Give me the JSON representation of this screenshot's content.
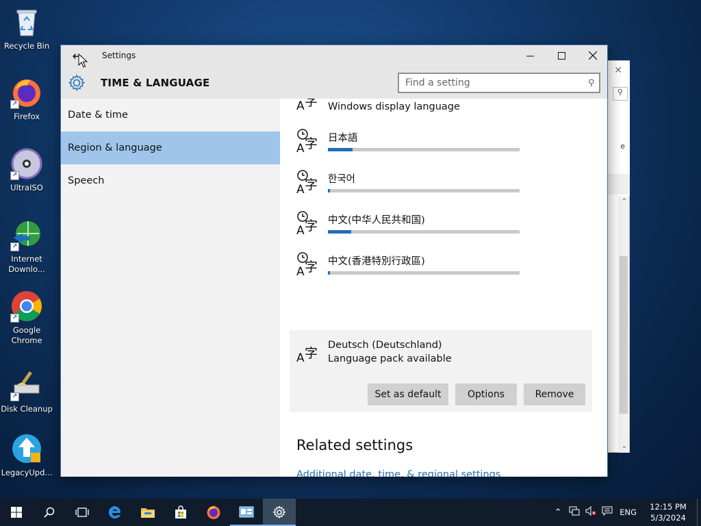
{
  "desktop": {
    "icons": [
      {
        "label": "Recycle Bin"
      },
      {
        "label": "Firefox"
      },
      {
        "label": "UltraISO"
      },
      {
        "label": "Internet Downlo..."
      },
      {
        "label": "Google Chrome"
      },
      {
        "label": "Disk Cleanup"
      },
      {
        "label": "LegacyUpd..."
      }
    ]
  },
  "window": {
    "title": "Settings",
    "section_title": "TIME & LANGUAGE",
    "search": {
      "placeholder": "Find a setting"
    },
    "sidebar": {
      "items": [
        {
          "label": "Date & time",
          "active": false
        },
        {
          "label": "Region & language",
          "active": true
        },
        {
          "label": "Speech",
          "active": false
        }
      ]
    },
    "languages": [
      {
        "name": "",
        "subtitle": "Windows display language",
        "progress": null
      },
      {
        "name": "日本語",
        "subtitle": "",
        "progress": 0.13
      },
      {
        "name": "한국어",
        "subtitle": "",
        "progress": 0.01
      },
      {
        "name": "中文(中华人民共和国)",
        "subtitle": "",
        "progress": 0.12
      },
      {
        "name": "中文(香港特別行政區)",
        "subtitle": "",
        "progress": 0.01
      }
    ],
    "selected_language": {
      "name": "Deutsch (Deutschland)",
      "subtitle": "Language pack available",
      "buttons": {
        "set_default": "Set as default",
        "options": "Options",
        "remove": "Remove"
      }
    },
    "related": {
      "title": "Related settings",
      "link": "Additional date, time, & regional settings"
    }
  },
  "taskbar": {
    "language": "ENG",
    "time": "12:15 PM",
    "date": "5/3/2024"
  },
  "colors": {
    "accent": "#1f6fb8",
    "selection": "#9fc6ea",
    "taskbar": "#101b2b"
  }
}
